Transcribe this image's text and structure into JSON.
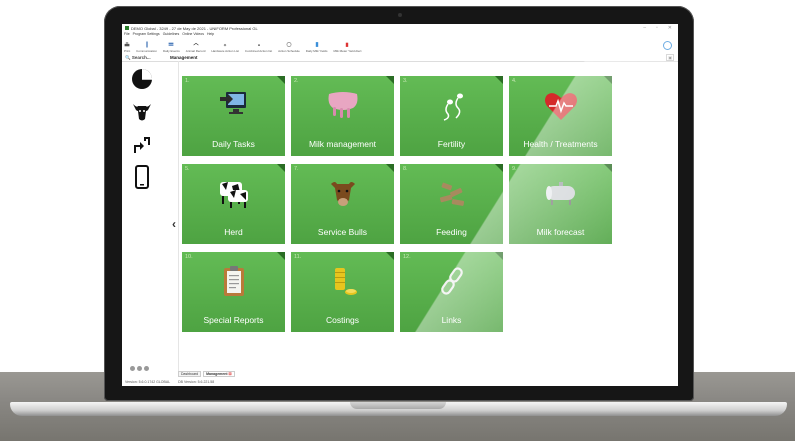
{
  "window": {
    "title": "DEMO Global - 3249 - 27 de May de 2021 - UNIFORM Professional GL",
    "controls": [
      "–",
      "▫",
      "✕"
    ]
  },
  "menu": [
    "File",
    "Program Settings",
    "Guidelines",
    "Online Videos",
    "Help"
  ],
  "toolbar": [
    {
      "label": "Print",
      "icon": "printer-icon"
    },
    {
      "label": "Communication",
      "icon": "communication-icon"
    },
    {
      "label": "Daily Events",
      "icon": "daily-events-icon"
    },
    {
      "label": "Animal Record",
      "icon": "animal-record-icon"
    },
    {
      "label": "Hardware Action List",
      "icon": "hardware-icon"
    },
    {
      "label": "Combined Action list",
      "icon": "combined-list-icon"
    },
    {
      "label": "Action Schedule",
      "icon": "clock-icon"
    },
    {
      "label": "Daily Milk Yields",
      "icon": "milk-yields-icon"
    },
    {
      "label": "Milk Meter Yield Alert",
      "icon": "alert-icon"
    }
  ],
  "search": {
    "label": "Search..."
  },
  "breadcrumb": "Management",
  "tiles": [
    {
      "num": "1.",
      "label": "Daily Tasks",
      "icon": "monitor-login-icon"
    },
    {
      "num": "2.",
      "label": "Milk management",
      "icon": "udder-icon"
    },
    {
      "num": "3.",
      "label": "Fertility",
      "icon": "sperm-icon"
    },
    {
      "num": "4.",
      "label": "Health / Treatments",
      "icon": "heart-icon"
    },
    {
      "num": "5.",
      "label": "Herd",
      "icon": "cows-icon"
    },
    {
      "num": "7.",
      "label": "Service Bulls",
      "icon": "bull-icon"
    },
    {
      "num": "8.",
      "label": "Feeding",
      "icon": "feed-bales-icon"
    },
    {
      "num": "9.",
      "label": "Milk forecast",
      "icon": "milk-tank-icon"
    },
    {
      "num": "10.",
      "label": "Special Reports",
      "icon": "clipboard-icon"
    },
    {
      "num": "11.",
      "label": "Costings",
      "icon": "coins-icon"
    },
    {
      "num": "12.",
      "label": "Links",
      "icon": "chain-link-icon"
    }
  ],
  "tabs": [
    {
      "label": "Dashboard"
    },
    {
      "label": "Management"
    }
  ],
  "status": {
    "version": "Version: 5.6.0.1742 GLOBAL",
    "db_version": "DB Version: 5.6.221.58"
  },
  "colors": {
    "tile_green": "#55b04a",
    "tile_corner": "#2a6d24",
    "tile_number": "#c9e8b6"
  }
}
